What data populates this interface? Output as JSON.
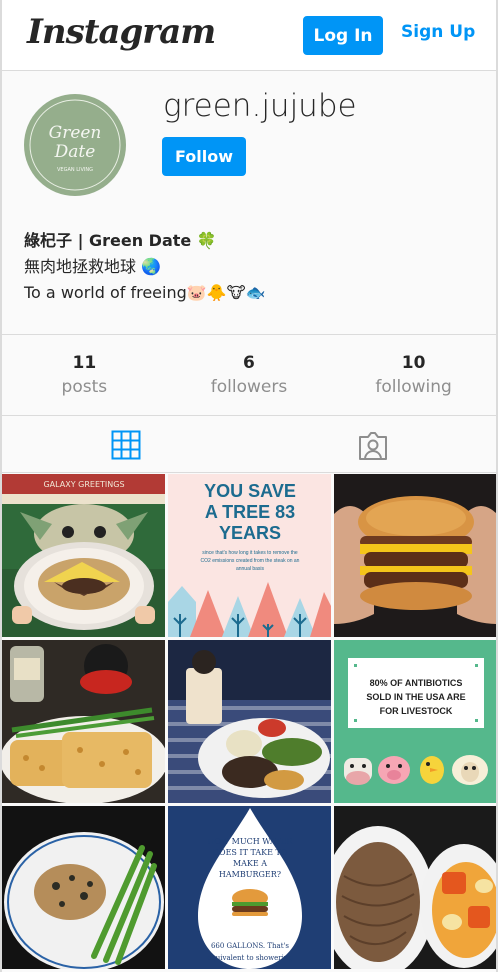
{
  "header": {
    "logo": "Instagram",
    "login_label": "Log In",
    "signup_label": "Sign Up"
  },
  "profile": {
    "username": "green.jujube",
    "follow_label": "Follow",
    "avatar": {
      "line1": "Green",
      "line2": "Date",
      "tagline": "VEGAN LIVING"
    },
    "bio": {
      "name": "綠杞子 | Green Date 🍀",
      "line2": "無肉地拯救地球 🌏",
      "line3": "To a world of freeing🐷🐥🐮🐟"
    }
  },
  "stats": [
    {
      "value": "11",
      "label": "posts"
    },
    {
      "value": "6",
      "label": "followers"
    },
    {
      "value": "10",
      "label": "following"
    }
  ],
  "posts": {
    "tree": {
      "title1": "YOU SAVE",
      "title2": "A TREE 83",
      "title3": "YEARS",
      "body1": "since that's how long it takes to remove the",
      "body2": "CO2 emissions created from the steak on an",
      "body3": "annual basis"
    },
    "antibiotics": {
      "line1": "80% OF ANTIBIOTICS",
      "line2": "SOLD IN THE USA ARE",
      "line3": "FOR LIVESTOCK"
    },
    "water": {
      "q1": "HOW MUCH WATER",
      "q2": "DOES IT TAKE TO",
      "q3": "MAKE A",
      "q4": "HAMBURGER?",
      "a1": "660 GALLONS. That's",
      "a2": "equivalent to showering"
    },
    "sweater_text": "GALAXY GREETINGS"
  },
  "colors": {
    "accent": "#0095f6",
    "border": "#dbdbdb",
    "muted": "#8e8e8e",
    "avatar_bg": "#95ae8c"
  }
}
